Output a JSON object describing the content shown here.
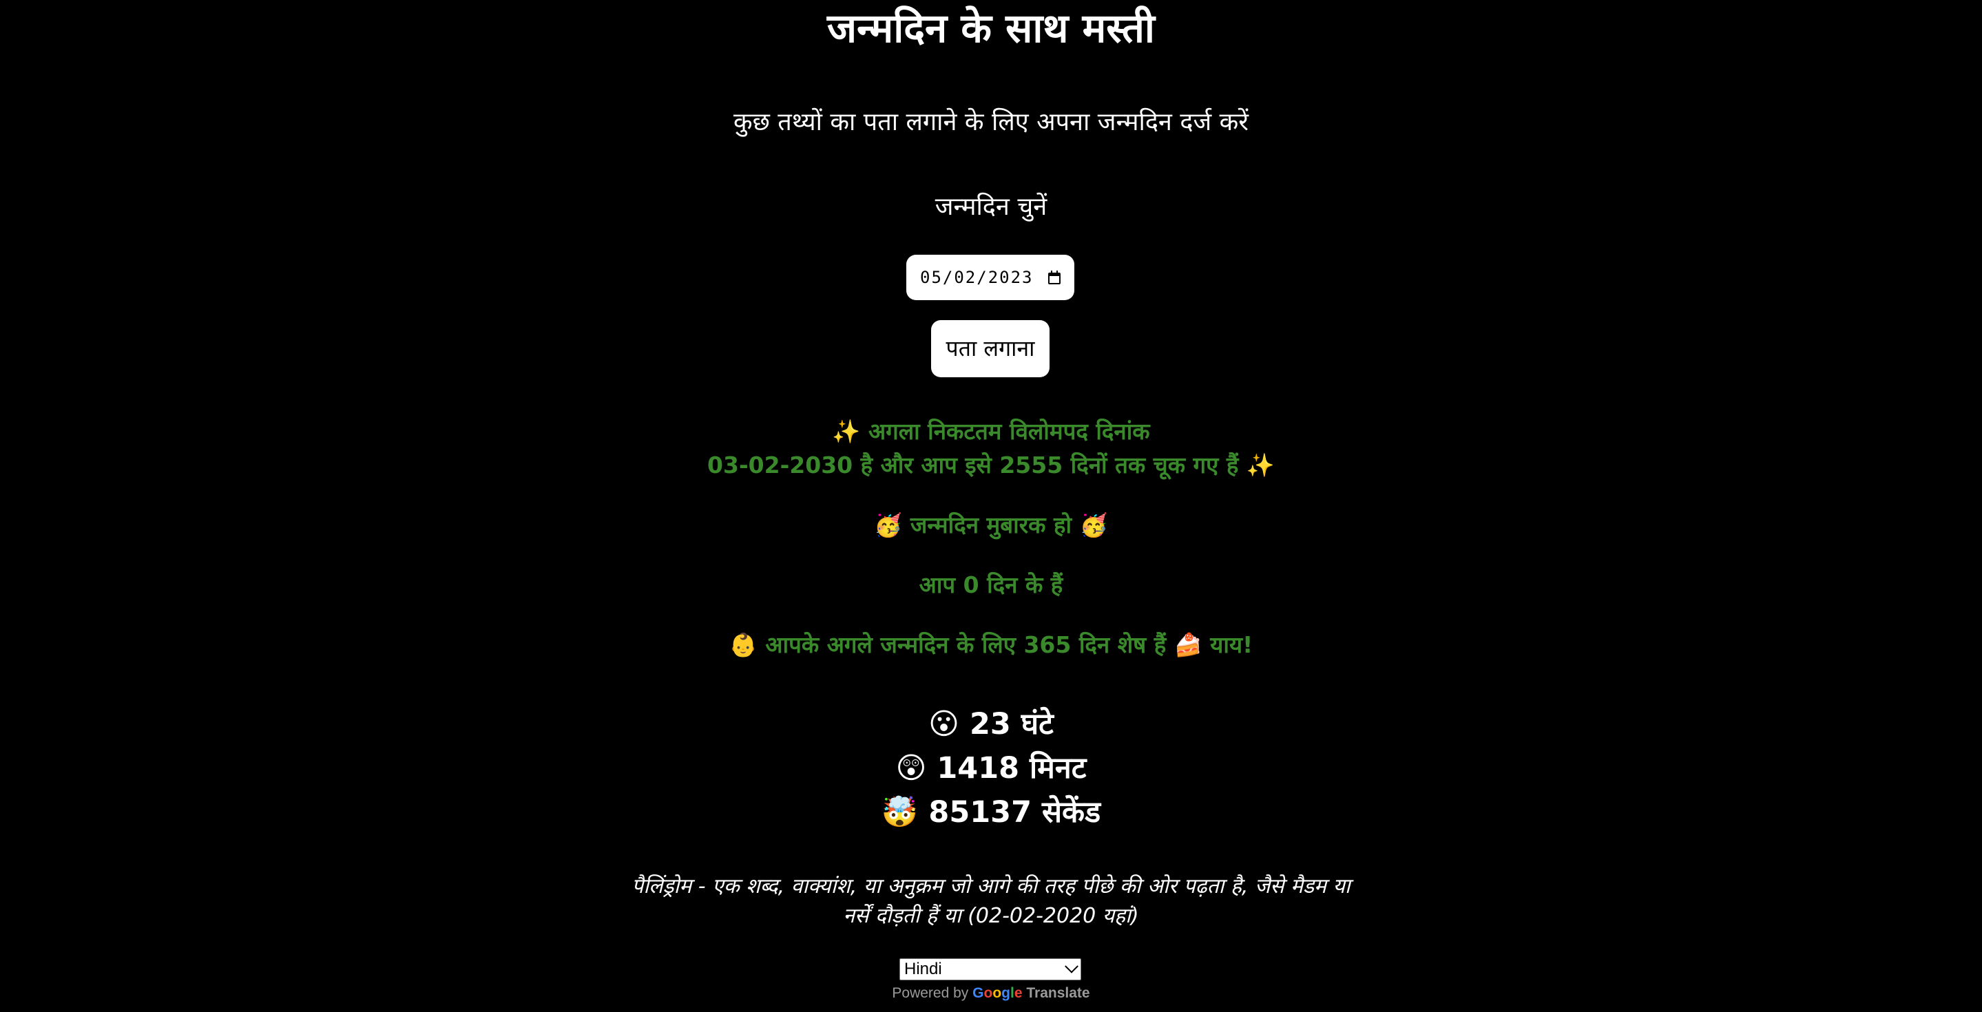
{
  "header": {
    "title": "जन्मदिन के साथ मस्ती",
    "subtitle": "कुछ तथ्यों का पता लगाने के लिए अपना जन्मदिन दर्ज करें"
  },
  "form": {
    "picker_label": "जन्मदिन चुनें",
    "date_value": "05/02/2023",
    "submit_label": "पता लगाना"
  },
  "results": {
    "palindrome_line1": "✨ अगला निकटतम विलोमपद दिनांक",
    "palindrome_line2": "03-02-2030 है और आप इसे 2555 दिनों तक चूक गए हैं ✨",
    "birthday_wish": "🥳 जन्मदिन मुबारक हो 🥳",
    "age": "आप 0 दिन के हैं",
    "next_birthday": "👶 आपके अगले जन्मदिन के लिए 365 दिन शेष हैं 🍰 याय!"
  },
  "stats": {
    "hours": "😮 23 घंटे",
    "minutes": "😲 1418 मिनट",
    "seconds": "🤯 85137 सेकेंड"
  },
  "definition": {
    "text": "पैलिंड्रोम - एक शब्द, वाक्यांश, या अनुक्रम जो आगे की तरह पीछे की ओर पढ़ता है, जैसे मैडम या नर्सें दौड़ती हैं या (02-02-2020 यहां)"
  },
  "translate": {
    "selected_language": "Hindi",
    "powered_by": "Powered by",
    "google_letters": [
      "G",
      "o",
      "o",
      "g",
      "l",
      "e"
    ],
    "translate_label": "Translate"
  },
  "colors": {
    "background": "#000000",
    "result_green": "#3a8a2c",
    "text": "#ffffff"
  },
  "icons": {
    "date_picker": "calendar-icon",
    "select": "chevron-down-icon"
  }
}
